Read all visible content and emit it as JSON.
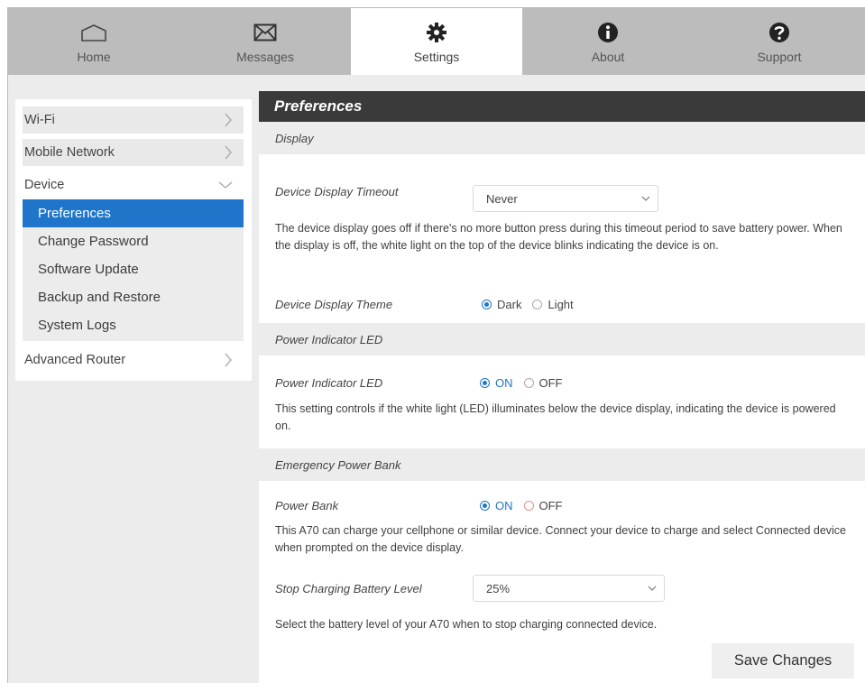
{
  "nav": {
    "tabs": [
      {
        "label": "Home",
        "icon": "home-icon"
      },
      {
        "label": "Messages",
        "icon": "envelope-icon"
      },
      {
        "label": "Settings",
        "icon": "gear-icon"
      },
      {
        "label": "About",
        "icon": "info-icon"
      },
      {
        "label": "Support",
        "icon": "question-icon"
      }
    ],
    "active": "Settings"
  },
  "sidebar": {
    "items": [
      {
        "label": "Wi-Fi"
      },
      {
        "label": "Mobile Network"
      },
      {
        "label": "Device"
      },
      {
        "label": "Advanced Router"
      }
    ],
    "device_submenu": [
      {
        "label": "Preferences"
      },
      {
        "label": "Change Password"
      },
      {
        "label": "Software Update"
      },
      {
        "label": "Backup and Restore"
      },
      {
        "label": "System Logs"
      }
    ]
  },
  "main": {
    "title": "Preferences",
    "display": {
      "heading": "Display",
      "timeout_label": "Device Display Timeout",
      "timeout_value": "Never",
      "timeout_desc": "The device display goes off if there's no more button press during this timeout period to save battery power. When the display is off, the white light on the top of the device blinks indicating the device is on.",
      "theme_label": "Device Display Theme",
      "theme_options": [
        "Dark",
        "Light"
      ],
      "theme_selected": "Dark"
    },
    "led": {
      "heading": "Power Indicator LED",
      "label": "Power Indicator LED",
      "options": [
        "ON",
        "OFF"
      ],
      "selected": "ON",
      "desc": "This setting controls if the white light (LED) illuminates below the device display, indicating the device is powered on."
    },
    "power_bank": {
      "heading": "Emergency Power Bank",
      "label": "Power Bank",
      "options": [
        "ON",
        "OFF"
      ],
      "selected": "ON",
      "desc": "This A70 can charge your cellphone or similar device. Connect your device to charge and select Connected device when prompted on the device display.",
      "stop_label": "Stop Charging Battery Level",
      "stop_value": "25%",
      "stop_desc": "Select the battery level of your A70 when to stop charging connected device."
    },
    "save_label": "Save Changes"
  },
  "colors": {
    "accent": "#1f75c9",
    "title_bar": "#3a3a3a",
    "nav_bg": "#bcbcbc"
  }
}
